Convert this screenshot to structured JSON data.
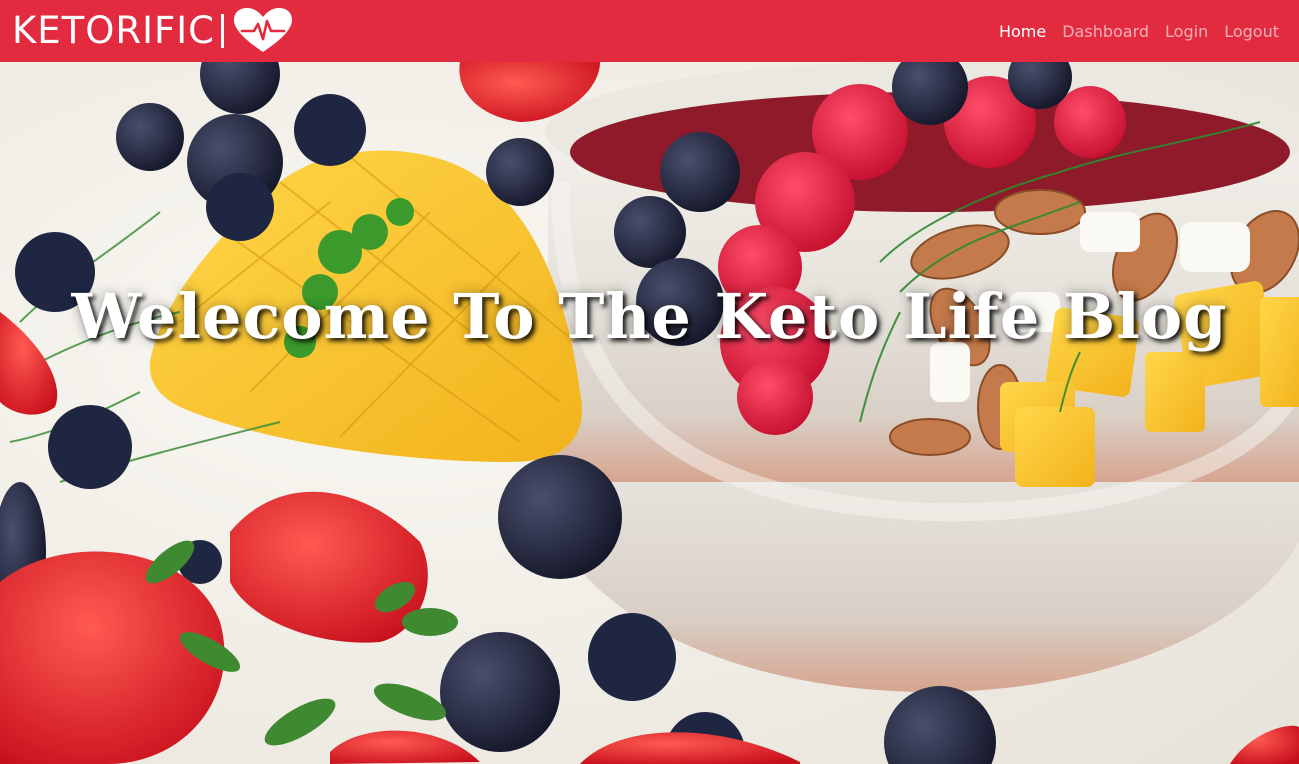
{
  "navbar": {
    "brand": "KETORIFIC",
    "brand_color": "#e22b3e",
    "brand_icon": "heart-pulse-icon",
    "links": [
      {
        "label": "Home",
        "active": true
      },
      {
        "label": "Dashboard",
        "active": false
      },
      {
        "label": "Login",
        "active": false
      },
      {
        "label": "Logout",
        "active": false
      }
    ]
  },
  "hero": {
    "title": "Welecome To The Keto Life Blog",
    "image": "fruit-bowl-hero-image"
  }
}
